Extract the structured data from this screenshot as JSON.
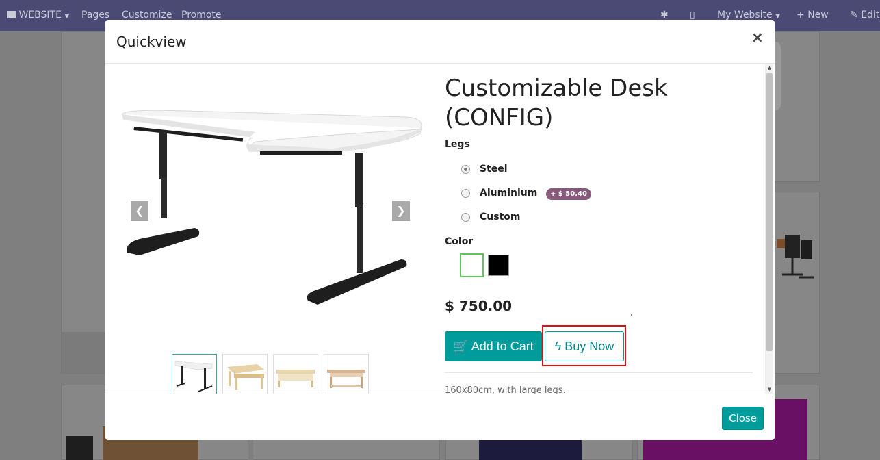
{
  "topbar": {
    "website_menu": "WEBSITE",
    "pages": "Pages",
    "customize": "Customize",
    "promote": "Promote",
    "my_website": "My Website",
    "new": "New",
    "edit": "Edit"
  },
  "modal": {
    "title": "Quickview",
    "close_x": "×",
    "close_button": "Close"
  },
  "product": {
    "name": "Customizable Desk (CONFIG)",
    "price": "$ 750.00",
    "description": "160x80cm, with large legs.",
    "attributes": {
      "legs_title": "Legs",
      "legs_options": [
        {
          "label": "Steel",
          "selected": true
        },
        {
          "label": "Aluminium",
          "badge": "+ $ 50.40",
          "selected": false
        },
        {
          "label": "Custom",
          "selected": false
        }
      ],
      "color_title": "Color",
      "colors": [
        {
          "value": "#ffffff",
          "selected": true
        },
        {
          "value": "#000000",
          "selected": false
        }
      ]
    },
    "add_to_cart": "Add to Cart",
    "buy_now": "Buy Now"
  },
  "icons": {
    "carousel_prev": "chevron-left-icon",
    "carousel_next": "chevron-right-icon",
    "cart": "cart-icon",
    "bolt": "bolt-icon"
  },
  "colors": {
    "accent": "#009b9b",
    "badge": "#875a7b",
    "topbar": "#4a4a74",
    "highlight": "#dd1111"
  }
}
